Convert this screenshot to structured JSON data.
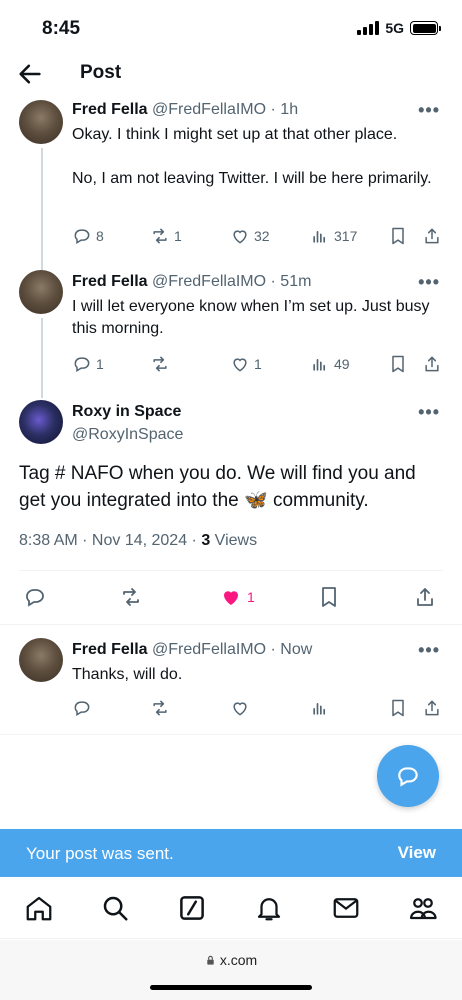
{
  "status_bar": {
    "time": "8:45",
    "network": "5G"
  },
  "header": {
    "title": "Post"
  },
  "tweets": [
    {
      "name": "Fred Fella",
      "meta": "@FredFellaIMO · 1h",
      "text": "Okay. I think I might set up at that other place.\n\nNo, I am not leaving Twitter. I will be here primarily.",
      "replies": "8",
      "reposts": "1",
      "likes": "32",
      "views": "317"
    },
    {
      "name": "Fred Fella",
      "meta": "@FredFellaIMO · 51m",
      "text": "I will let everyone know when I’m set up. Just busy this morning.",
      "replies": "1",
      "reposts": "",
      "likes": "1",
      "views": "49"
    }
  ],
  "focus": {
    "name": "Roxy in Space",
    "handle": "@RoxyInSpace",
    "text_before": "Tag # NAFO when you do. We will find you and get you integrated into the ",
    "emoji": "🦋",
    "text_after": " community.",
    "timestamp": "8:38 AM · Nov 14, 2024 · ",
    "views_count": "3",
    "views_label": " Views",
    "likes": "1",
    "like_color": "#f91880"
  },
  "reply": {
    "name": "Fred Fella",
    "meta": "@FredFellaIMO · Now",
    "text": "Thanks, will do."
  },
  "more_label": "•••",
  "toast": {
    "text": "Your post was sent.",
    "action": "View"
  },
  "tabbar": [
    "home-icon",
    "search-icon",
    "grok-icon",
    "notifications-icon",
    "messages-icon",
    "communities-icon"
  ],
  "browser": {
    "url": "x.com"
  },
  "colors": {
    "accent": "#4aa5ec",
    "text": "#0f1419",
    "muted": "#536471",
    "like": "#f91880"
  }
}
